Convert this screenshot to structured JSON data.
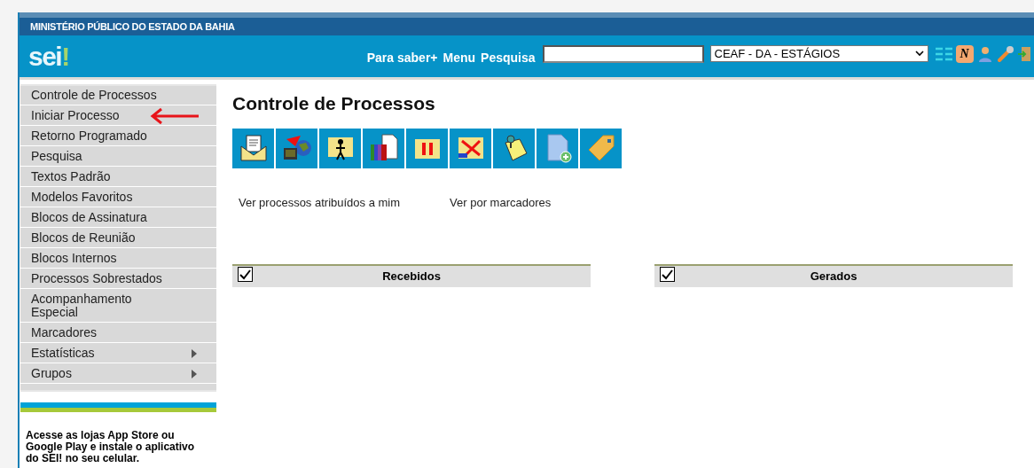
{
  "header": {
    "org": "MINISTÉRIO PÚBLICO DO ESTADO DA BAHIA",
    "logo": "sei",
    "logo_mark": "!",
    "nav": [
      {
        "label": "Para saber+"
      },
      {
        "label": "Menu"
      },
      {
        "label": "Pesquisa"
      }
    ],
    "unit_select": {
      "value": "CEAF - DA - ESTÁGIOS"
    },
    "notice_badge": "N"
  },
  "sidebar": {
    "items": [
      {
        "label": "Controle de Processos",
        "submenu": false,
        "annotated": false
      },
      {
        "label": "Iniciar Processo",
        "submenu": false,
        "annotated": true
      },
      {
        "label": "Retorno Programado",
        "submenu": false,
        "annotated": false
      },
      {
        "label": "Pesquisa",
        "submenu": false,
        "annotated": false
      },
      {
        "label": "Textos Padrão",
        "submenu": false,
        "annotated": false
      },
      {
        "label": "Modelos Favoritos",
        "submenu": false,
        "annotated": false
      },
      {
        "label": "Blocos de Assinatura",
        "submenu": false,
        "annotated": false
      },
      {
        "label": "Blocos de Reunião",
        "submenu": false,
        "annotated": false
      },
      {
        "label": "Blocos Internos",
        "submenu": false,
        "annotated": false
      },
      {
        "label": "Processos Sobrestados",
        "submenu": false,
        "annotated": false
      },
      {
        "label": "Acompanhamento Especial",
        "submenu": false,
        "annotated": false
      },
      {
        "label": "Marcadores",
        "submenu": false,
        "annotated": false
      },
      {
        "label": "Estatísticas",
        "submenu": true,
        "annotated": false
      },
      {
        "label": "Grupos",
        "submenu": true,
        "annotated": false
      }
    ],
    "promo": "Acesse as lojas App Store ou Google Play e instale o aplicativo do SEI! no seu celular."
  },
  "main": {
    "title": "Controle de Processos",
    "toolbar": [
      {
        "kind": "envelope"
      },
      {
        "kind": "globe"
      },
      {
        "kind": "person"
      },
      {
        "kind": "books"
      },
      {
        "kind": "pause"
      },
      {
        "kind": "cancel"
      },
      {
        "kind": "note"
      },
      {
        "kind": "newdoc"
      },
      {
        "kind": "tag"
      }
    ],
    "links": [
      {
        "label": "Ver processos atribuídos a mim"
      },
      {
        "label": "Ver por marcadores"
      }
    ],
    "tables": [
      {
        "title": "Recebidos",
        "checked": true
      },
      {
        "title": "Gerados",
        "checked": true
      }
    ]
  }
}
